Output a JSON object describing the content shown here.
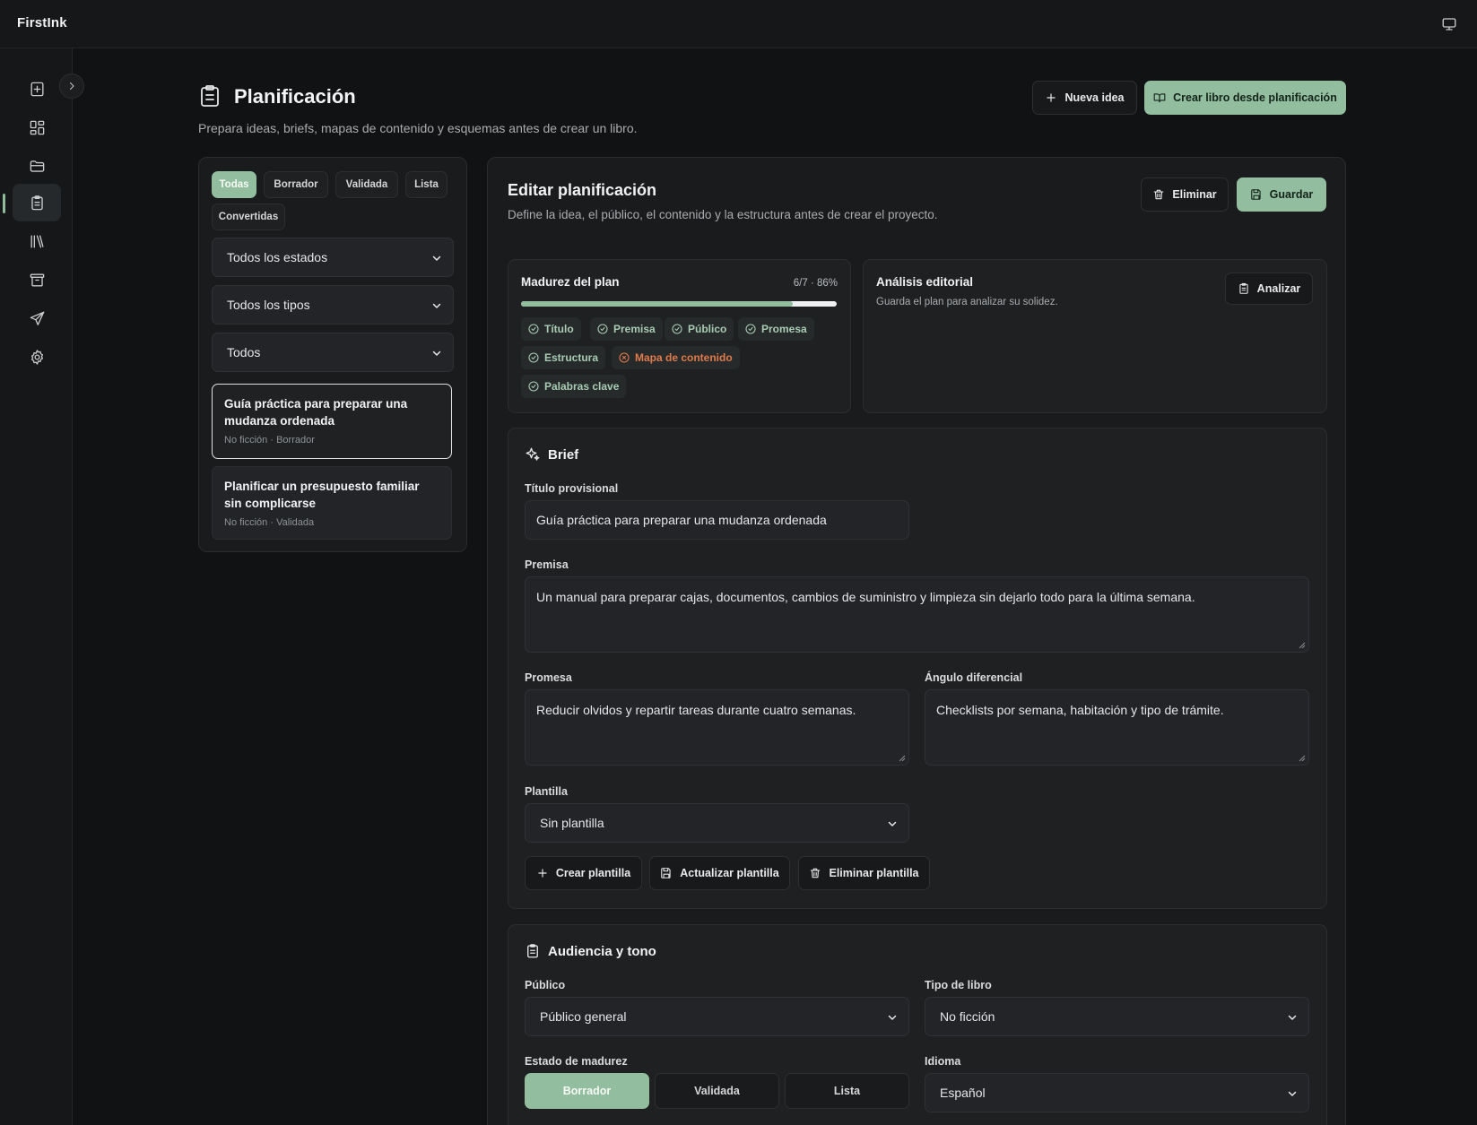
{
  "app": {
    "brand": "FirstInk"
  },
  "sidebar": {
    "items": [
      {
        "name": "new-book",
        "icon": "file-plus-icon"
      },
      {
        "name": "dashboard",
        "icon": "grid-icon"
      },
      {
        "name": "projects",
        "icon": "folder-icon"
      },
      {
        "name": "planning",
        "icon": "clipboard-icon",
        "active": true
      },
      {
        "name": "library",
        "icon": "books-icon"
      },
      {
        "name": "archive",
        "icon": "archive-icon"
      },
      {
        "name": "publish",
        "icon": "send-icon"
      },
      {
        "name": "settings",
        "icon": "gear-icon"
      }
    ]
  },
  "header": {
    "title": "Planificación",
    "subtitle": "Prepara ideas, briefs, mapas de contenido y esquemas antes de crear un libro.",
    "new_idea": "Nueva idea",
    "create_book": "Crear libro desde planificación"
  },
  "filters": {
    "chips": [
      "Todas",
      "Borrador",
      "Validada",
      "Lista",
      "Convertidas"
    ],
    "status_select": "Todos los estados",
    "type_select": "Todos los tipos",
    "other_select": "Todos"
  },
  "plans": [
    {
      "title": "Guía práctica para preparar una mudanza ordenada",
      "meta": "No ficción · Borrador"
    },
    {
      "title": "Planificar un presupuesto familiar sin complicarse",
      "meta": "No ficción · Validada"
    }
  ],
  "editor": {
    "title": "Editar planificación",
    "subtitle": "Define la idea, el público, el contenido y la estructura antes de crear el proyecto.",
    "delete": "Eliminar",
    "save": "Guardar"
  },
  "maturity": {
    "title": "Madurez del plan",
    "score": "6/7 · 86%",
    "progress": 0.86,
    "checks": [
      {
        "label": "Título",
        "ok": true
      },
      {
        "label": "Premisa",
        "ok": true
      },
      {
        "label": "Público",
        "ok": true
      },
      {
        "label": "Promesa",
        "ok": true
      },
      {
        "label": "Estructura",
        "ok": true
      },
      {
        "label": "Mapa de contenido",
        "ok": false
      },
      {
        "label": "Palabras clave",
        "ok": true
      }
    ]
  },
  "analysis": {
    "title": "Análisis editorial",
    "text": "Guarda el plan para analizar su solidez.",
    "button": "Analizar"
  },
  "brief": {
    "title": "Brief",
    "working_title_label": "Título provisional",
    "working_title": "Guía práctica para preparar una mudanza ordenada",
    "premise_label": "Premisa",
    "premise": "Un manual para preparar cajas, documentos, cambios de suministro y limpieza sin dejarlo todo para la última semana.",
    "promise_label": "Promesa",
    "promise": "Reducir olvidos y repartir tareas durante cuatro semanas.",
    "angle_label": "Ángulo diferencial",
    "angle": "Checklists por semana, habitación y tipo de trámite.",
    "template_label": "Plantilla",
    "template": "Sin plantilla",
    "create_template": "Crear plantilla",
    "update_template": "Actualizar plantilla",
    "delete_template": "Eliminar plantilla"
  },
  "audience": {
    "title": "Audiencia y tono",
    "public_label": "Público",
    "public": "Público general",
    "book_type_label": "Tipo de libro",
    "book_type": "No ficción",
    "maturity_label": "Estado de madurez",
    "maturity_options": [
      "Borrador",
      "Validada",
      "Lista"
    ],
    "maturity_selected": "Borrador",
    "language_label": "Idioma",
    "language": "Español"
  },
  "colors": {
    "accent": "#92bd9e",
    "warning": "#e07a4b",
    "background": "#111213"
  }
}
